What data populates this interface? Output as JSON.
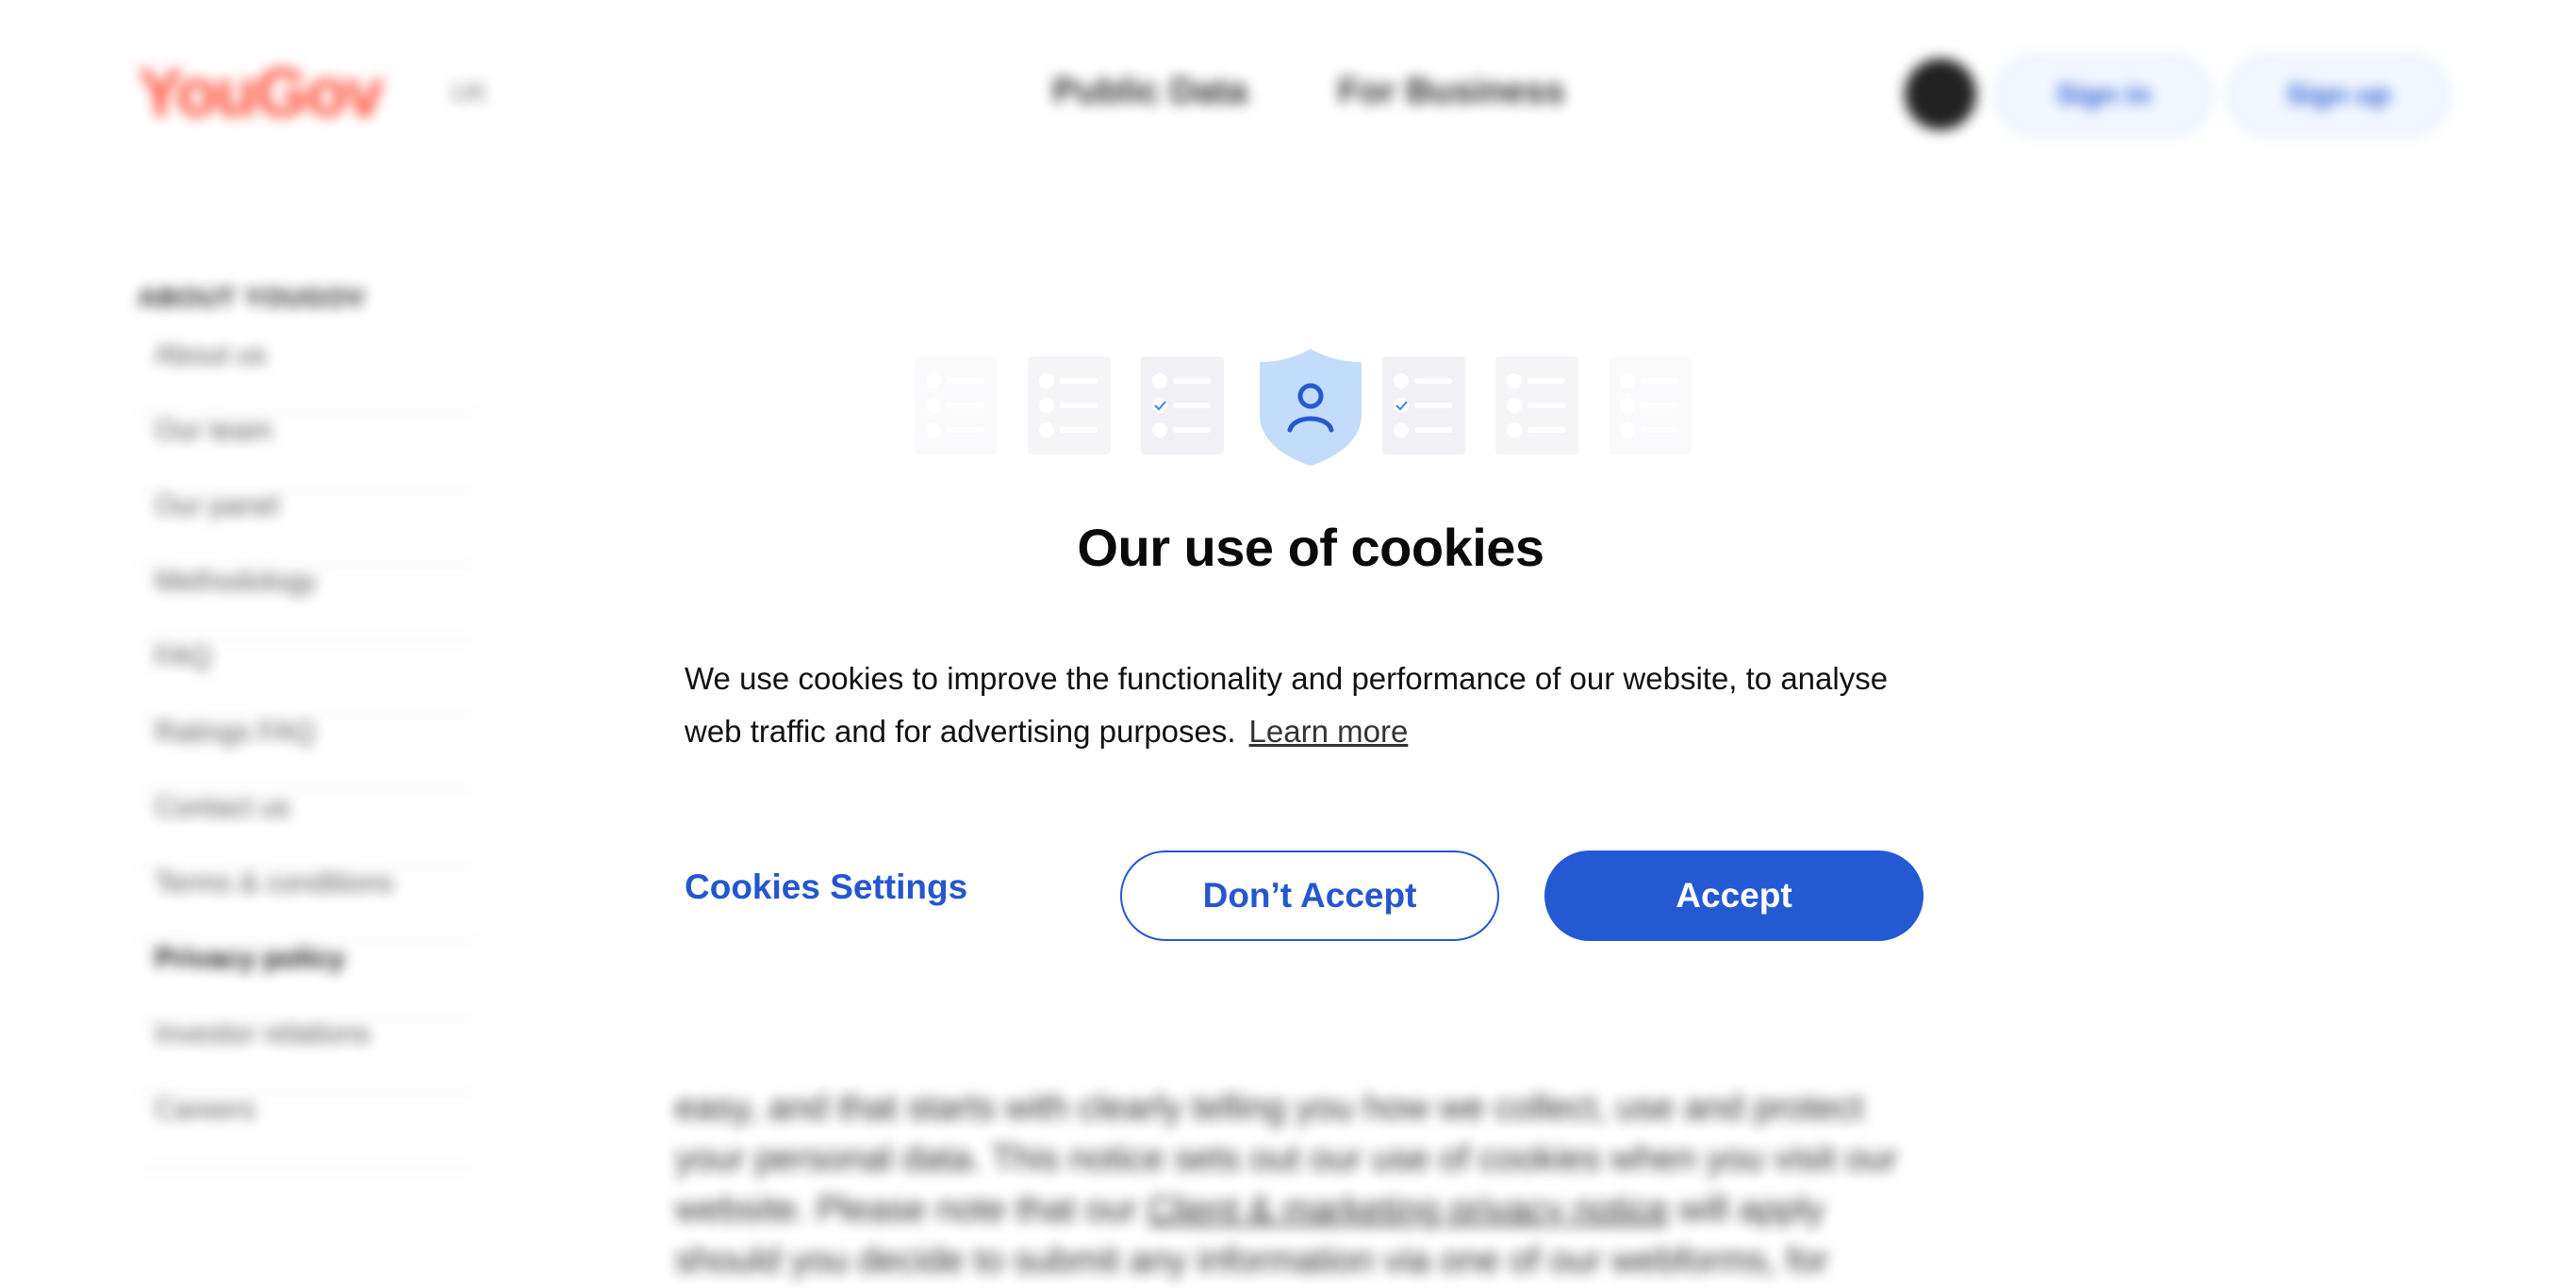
{
  "header": {
    "logo_text": "YouGov",
    "region": "UK",
    "nav": [
      {
        "label": "Public Data"
      },
      {
        "label": "For Business"
      }
    ],
    "sign_in_label": "Sign in",
    "sign_up_label": "Sign up"
  },
  "sidebar": {
    "heading": "ABOUT YOUGOV",
    "items": [
      {
        "label": "About us"
      },
      {
        "label": "Our team"
      },
      {
        "label": "Our panel"
      },
      {
        "label": "Methodology"
      },
      {
        "label": "FAQ"
      },
      {
        "label": "Ratings FAQ"
      },
      {
        "label": "Contact us"
      },
      {
        "label": "Terms & conditions"
      },
      {
        "label": "Privacy policy"
      },
      {
        "label": "Investor relations"
      },
      {
        "label": "Careers"
      }
    ]
  },
  "body": {
    "paragraph_start": "easy, and that starts with clearly telling you how we collect, use and protect your personal data. This notice sets out our use of cookies when you visit our website. Please note that our ",
    "paragraph_link": "Client & marketing privacy notice",
    "paragraph_end": " will apply should you decide to submit any information via one of our webforms, for"
  },
  "cookie_dialog": {
    "title": "Our use of cookies",
    "body": "We use cookies to improve the functionality and performance of our website, to analyse web traffic and for advertising purposes.",
    "learn_more": "Learn more",
    "settings_label": "Cookies Settings",
    "reject_label": "Don’t Accept",
    "accept_label": "Accept",
    "illustration_icon": "shield-user-icon"
  },
  "colors": {
    "brand_red": "#ff4f3a",
    "primary_blue": "#2559d3",
    "shield_fill": "#c4dcfb",
    "card_bg": "#f1f0f4"
  }
}
